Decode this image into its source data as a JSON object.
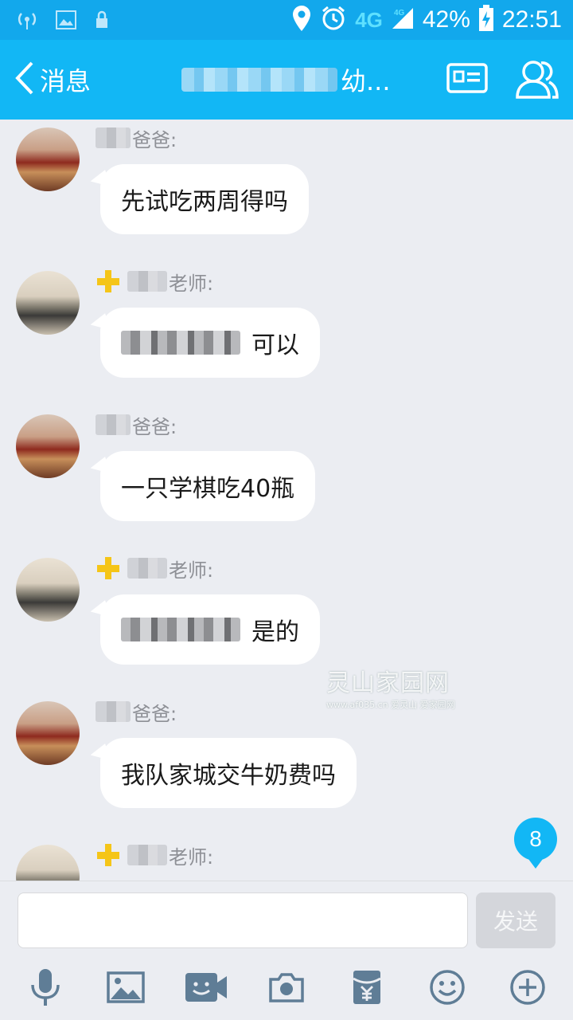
{
  "status_bar": {
    "network": "4G",
    "network_small": "4G",
    "battery": "42%",
    "time": "22:51"
  },
  "header": {
    "back_label": "消息",
    "title_suffix": "幼..."
  },
  "messages": [
    {
      "role": "爸爸:",
      "text": "先试吃两周得吗",
      "sender_type": "parent"
    },
    {
      "role": "老师:",
      "text": "可以",
      "sender_type": "teacher",
      "has_mention": true
    },
    {
      "role": "爸爸:",
      "text": "一只学棋吃40瓶",
      "sender_type": "parent"
    },
    {
      "role": "老师:",
      "text": "是的",
      "sender_type": "teacher",
      "has_mention": true
    },
    {
      "role": "爸爸:",
      "text": "我队家城交牛奶费吗",
      "sender_type": "parent"
    },
    {
      "role": "老师:",
      "text": "",
      "sender_type": "teacher"
    }
  ],
  "unread_count": "8",
  "input": {
    "placeholder": "",
    "send_label": "发送"
  },
  "toolbar_icons": [
    "microphone-icon",
    "image-icon",
    "video-chat-icon",
    "camera-icon",
    "red-packet-icon",
    "emoji-icon",
    "plus-icon"
  ],
  "watermark": {
    "title": "灵山家园网",
    "subtitle": "www.af035.cn 爱灵山 爱家园网"
  },
  "colors": {
    "header": "#12b7f5",
    "status_bar": "#12a8ec",
    "chat_bg": "#ebedf2",
    "bubble": "#ffffff",
    "badge": "#12b7f5"
  }
}
